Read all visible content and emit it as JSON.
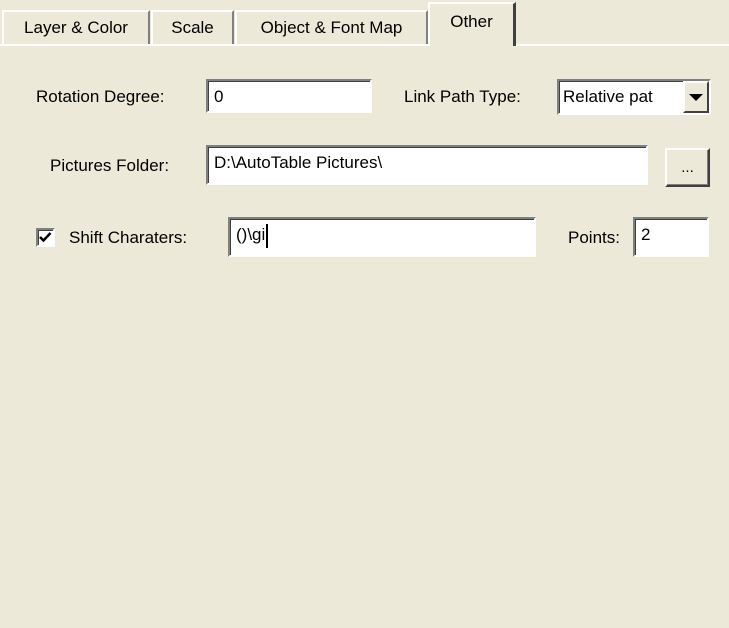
{
  "tabs": [
    {
      "label": "Layer & Color",
      "active": false
    },
    {
      "label": "Scale",
      "active": false
    },
    {
      "label": "Object & Font Map",
      "active": false
    },
    {
      "label": "Other",
      "active": true
    }
  ],
  "form": {
    "rotation_label": "Rotation Degree:",
    "rotation_value": "0",
    "link_path_label": "Link Path Type:",
    "link_path_value": "Relative pat",
    "pictures_label": "Pictures Folder:",
    "pictures_value": "D:\\AutoTable Pictures\\",
    "browse_label": "...",
    "shift_label": "Shift Charaters:",
    "shift_checked": true,
    "shift_value": "()\\gi",
    "points_label": "Points:",
    "points_value": "2"
  },
  "colors": {
    "face": "#ece9d8",
    "field": "#ffffff"
  }
}
